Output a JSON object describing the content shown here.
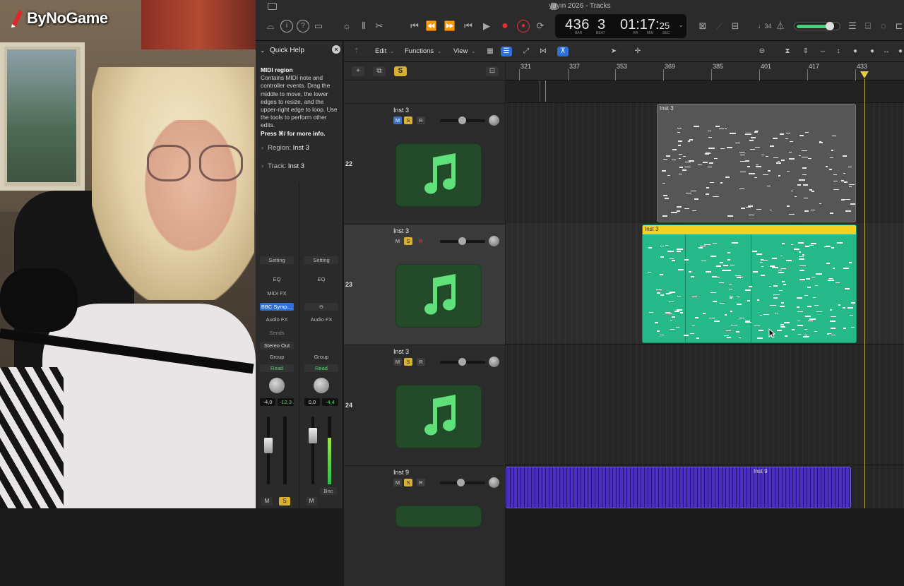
{
  "overlay": {
    "logo_text": "ByNoGame"
  },
  "window": {
    "title": "yayın 2026 - Tracks"
  },
  "lcd": {
    "bar": "436",
    "beat": "3",
    "time_main": "01:17:",
    "time_frac": "25",
    "labels": {
      "bar": "BAR",
      "beat": "BEAT",
      "hr": "HR",
      "min": "MIN",
      "sec": "SEC"
    }
  },
  "toolbar": {
    "tempo_text": "♩34",
    "master_level": 0.72
  },
  "quick_help": {
    "heading": "Quick Help",
    "title": "MIDI region",
    "body": "Contains MIDI note and controller events. Drag the middle to move, the lower edges to resize, and the upper-right edge to loop. Use the tools to perform other edits.",
    "more": "Press ⌘/ for more info.",
    "region_label": "Region:",
    "region_value": "Inst 3",
    "track_label": "Track:",
    "track_value": "Inst 3"
  },
  "inspector": {
    "left": {
      "setting": "Setting",
      "eq": "EQ",
      "midi_fx": "MIDI FX",
      "instrument": "BBC Symp…",
      "audio_fx": "Audio FX",
      "sends": "Sends",
      "output": "Stereo Out",
      "group": "Group",
      "automation": "Read",
      "vol": "-4,0",
      "peak": "-12,3",
      "mute": "M",
      "solo": "S"
    },
    "right": {
      "setting": "Setting",
      "eq": "EQ",
      "audio_fx": "Audio FX",
      "group": "Group",
      "automation": "Read",
      "vol": "0,0",
      "peak": "-4,4",
      "bounce": "Bnc",
      "mute": "M"
    }
  },
  "menus": {
    "edit": "Edit",
    "functions": "Functions",
    "view": "View"
  },
  "ruler": {
    "bars": [
      "321",
      "337",
      "353",
      "369",
      "385",
      "401",
      "417",
      "433"
    ]
  },
  "tracks": [
    {
      "number": "22",
      "name": "Inst 3",
      "mute": "M",
      "solo": "S",
      "rec": "R",
      "rec_armed": false
    },
    {
      "number": "23",
      "name": "Inst 3",
      "mute": "M",
      "solo": "S",
      "rec": "R",
      "rec_armed": true
    },
    {
      "number": "24",
      "name": "Inst 3",
      "mute": "M",
      "solo": "S",
      "rec": "R",
      "rec_armed": false
    },
    {
      "number": "",
      "name": "Inst 9",
      "mute": "M",
      "solo": "S",
      "rec": "R",
      "rec_armed": false
    }
  ],
  "regions": [
    {
      "name": "Inst 3",
      "track": 22,
      "color": "#5a5a5a"
    },
    {
      "name": "Inst 3",
      "track": 23,
      "color": "#25b98a",
      "selected": true
    },
    {
      "name": "Inst 9",
      "track": "Inst 9",
      "color": "#4a2fc0"
    }
  ],
  "header_buttons": {
    "add": "+",
    "solo": "S"
  }
}
